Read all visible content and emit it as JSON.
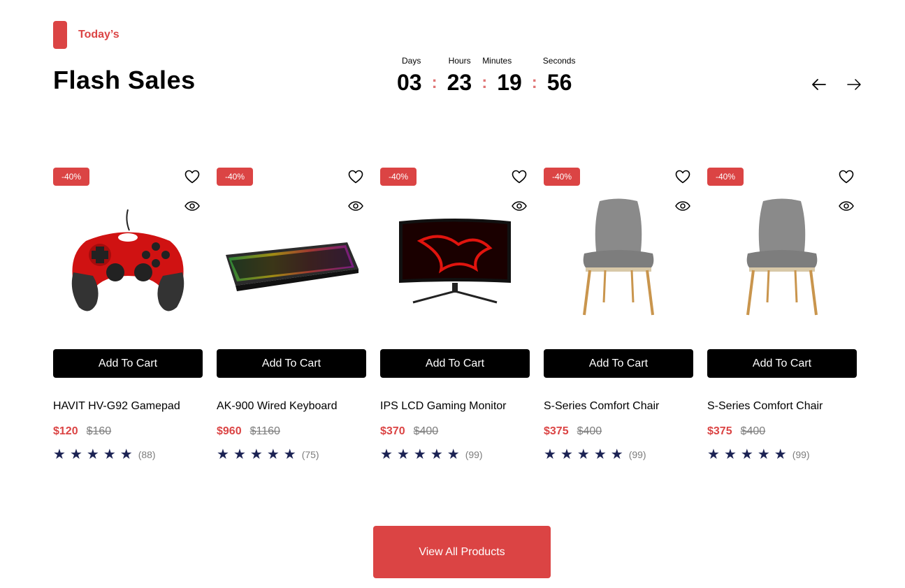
{
  "section": {
    "tag": "Today’s",
    "title": "Flash Sales"
  },
  "countdown": [
    {
      "label": "Days",
      "value": "03"
    },
    {
      "label": "Hours",
      "value": "23"
    },
    {
      "label": "Minutes",
      "value": "19"
    },
    {
      "label": "Seconds",
      "value": "56"
    }
  ],
  "separator": ":",
  "colors": {
    "accent": "#DB4444",
    "star": "#1B2253",
    "muted": "#7D7D7D",
    "button": "#000000"
  },
  "icons": {
    "prev": "arrow-left-icon",
    "next": "arrow-right-icon",
    "wishlist": "heart-icon",
    "quick_view": "eye-icon",
    "star": "star-icon"
  },
  "products": [
    {
      "discount": "-40%",
      "name": "HAVIT HV-G92 Gamepad",
      "price": "$120",
      "old_price": "$160",
      "reviews": "(88)",
      "stars": 5,
      "cart_label": "Add To Cart",
      "image": "gamepad"
    },
    {
      "discount": "-40%",
      "name": "AK-900 Wired Keyboard",
      "price": "$960",
      "old_price": "$1160",
      "reviews": "(75)",
      "stars": 5,
      "cart_label": "Add To Cart",
      "image": "keyboard"
    },
    {
      "discount": "-40%",
      "name": "IPS LCD Gaming Monitor",
      "price": "$370",
      "old_price": "$400",
      "reviews": "(99)",
      "stars": 5,
      "cart_label": "Add To Cart",
      "image": "monitor"
    },
    {
      "discount": "-40%",
      "name": "S-Series Comfort Chair",
      "price": "$375",
      "old_price": "$400",
      "reviews": "(99)",
      "stars": 5,
      "cart_label": "Add To Cart",
      "image": "chair"
    },
    {
      "discount": "-40%",
      "name": "S-Series Comfort Chair",
      "price": "$375",
      "old_price": "$400",
      "reviews": "(99)",
      "stars": 5,
      "cart_label": "Add To Cart",
      "image": "chair"
    }
  ],
  "footer": {
    "view_all": "View All Products"
  }
}
